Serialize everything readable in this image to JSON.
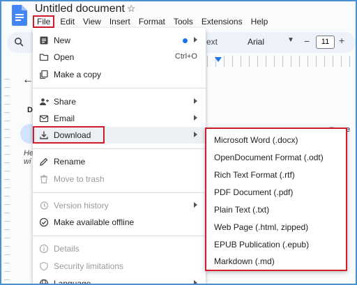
{
  "document": {
    "title": "Untitled document"
  },
  "menubar": [
    "File",
    "Edit",
    "View",
    "Insert",
    "Format",
    "Tools",
    "Extensions",
    "Help"
  ],
  "toolbar": {
    "text_style": "ext",
    "font": "Arial",
    "font_size": "11",
    "minus": "−",
    "plus": "+"
  },
  "page": {
    "heading_fragment": "D",
    "italic_1": "He",
    "italic_2": "wi",
    "right_fragment": "e"
  },
  "file_menu": {
    "new": "New",
    "open": "Open",
    "open_shortcut": "Ctrl+O",
    "make_copy": "Make a copy",
    "share": "Share",
    "email": "Email",
    "download": "Download",
    "rename": "Rename",
    "move_to_trash": "Move to trash",
    "version_history": "Version history",
    "make_offline": "Make available offline",
    "details": "Details",
    "security": "Security limitations",
    "language": "Language"
  },
  "download_submenu": [
    "Microsoft Word (.docx)",
    "OpenDocument Format (.odt)",
    "Rich Text Format (.rtf)",
    "PDF Document (.pdf)",
    "Plain Text (.txt)",
    "Web Page (.html, zipped)",
    "EPUB Publication (.epub)",
    "Markdown (.md)"
  ],
  "colors": {
    "accent": "#1a73e8",
    "highlight_box": "#d11a2a",
    "toolbar_bg": "#edf2fa"
  }
}
